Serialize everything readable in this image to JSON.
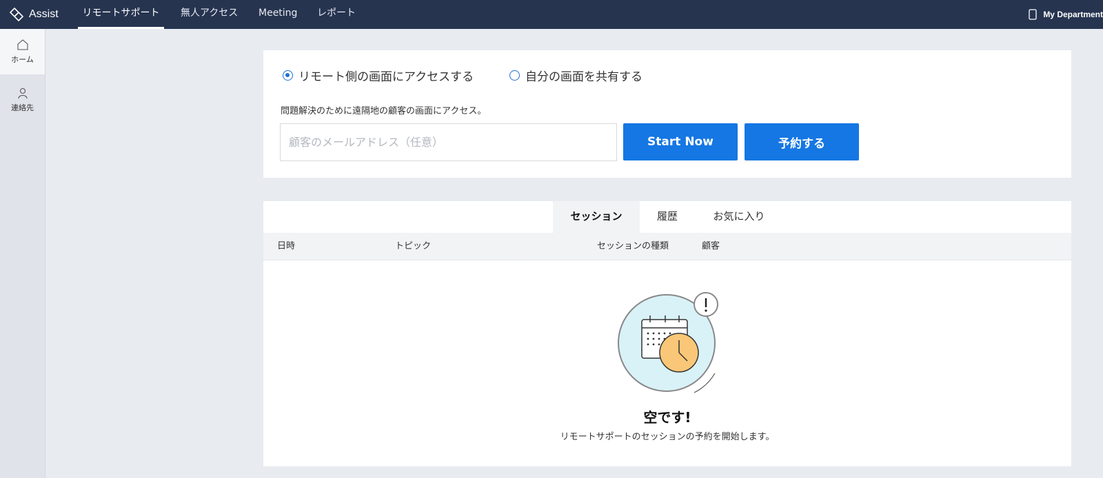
{
  "app": {
    "name": "Assist"
  },
  "nav": {
    "items": [
      {
        "label": "リモートサポート",
        "active": true
      },
      {
        "label": "無人アクセス"
      },
      {
        "label": "Meeting"
      },
      {
        "label": "レポート"
      }
    ],
    "department": "My Department"
  },
  "sidebar": {
    "items": [
      {
        "label": "ホーム",
        "icon": "home-icon",
        "active": true
      },
      {
        "label": "連絡先",
        "icon": "contact-icon"
      }
    ]
  },
  "access": {
    "options": [
      {
        "label": "リモート側の画面にアクセスする",
        "checked": true
      },
      {
        "label": "自分の画面を共有する",
        "checked": false
      }
    ],
    "description": "問題解決のために遠隔地の顧客の画面にアクセス。",
    "email_placeholder": "顧客のメールアドレス（任意）",
    "email_value": "",
    "start_label": "Start Now",
    "schedule_label": "予約する"
  },
  "sessions": {
    "tabs": [
      {
        "label": "セッション",
        "active": true
      },
      {
        "label": "履歴"
      },
      {
        "label": "お気に入り"
      }
    ],
    "columns": [
      "日時",
      "トピック",
      "セッションの種類",
      "顧客"
    ],
    "rows": [],
    "empty": {
      "title": "空です!",
      "subtitle": "リモートサポートのセッションの予約を開始します。"
    }
  },
  "colors": {
    "topbar": "#263450",
    "primary_button": "#1577e3",
    "radio": "#1f6fd6",
    "illustration_bg": "#d9f2f7",
    "clock": "#f9c777"
  }
}
